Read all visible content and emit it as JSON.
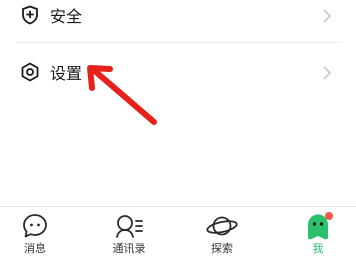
{
  "menu": {
    "security_label": "安全",
    "settings_label": "设置"
  },
  "tabs": [
    {
      "label": "消息",
      "icon": "message-bubble-icon"
    },
    {
      "label": "通讯录",
      "icon": "contacts-icon"
    },
    {
      "label": "探索",
      "icon": "planet-icon"
    },
    {
      "label": "我",
      "icon": "avatar-icon"
    }
  ],
  "colors": {
    "accent": "#2bc06c",
    "arrow": "#e8201b",
    "badge": "#f25a4a"
  }
}
